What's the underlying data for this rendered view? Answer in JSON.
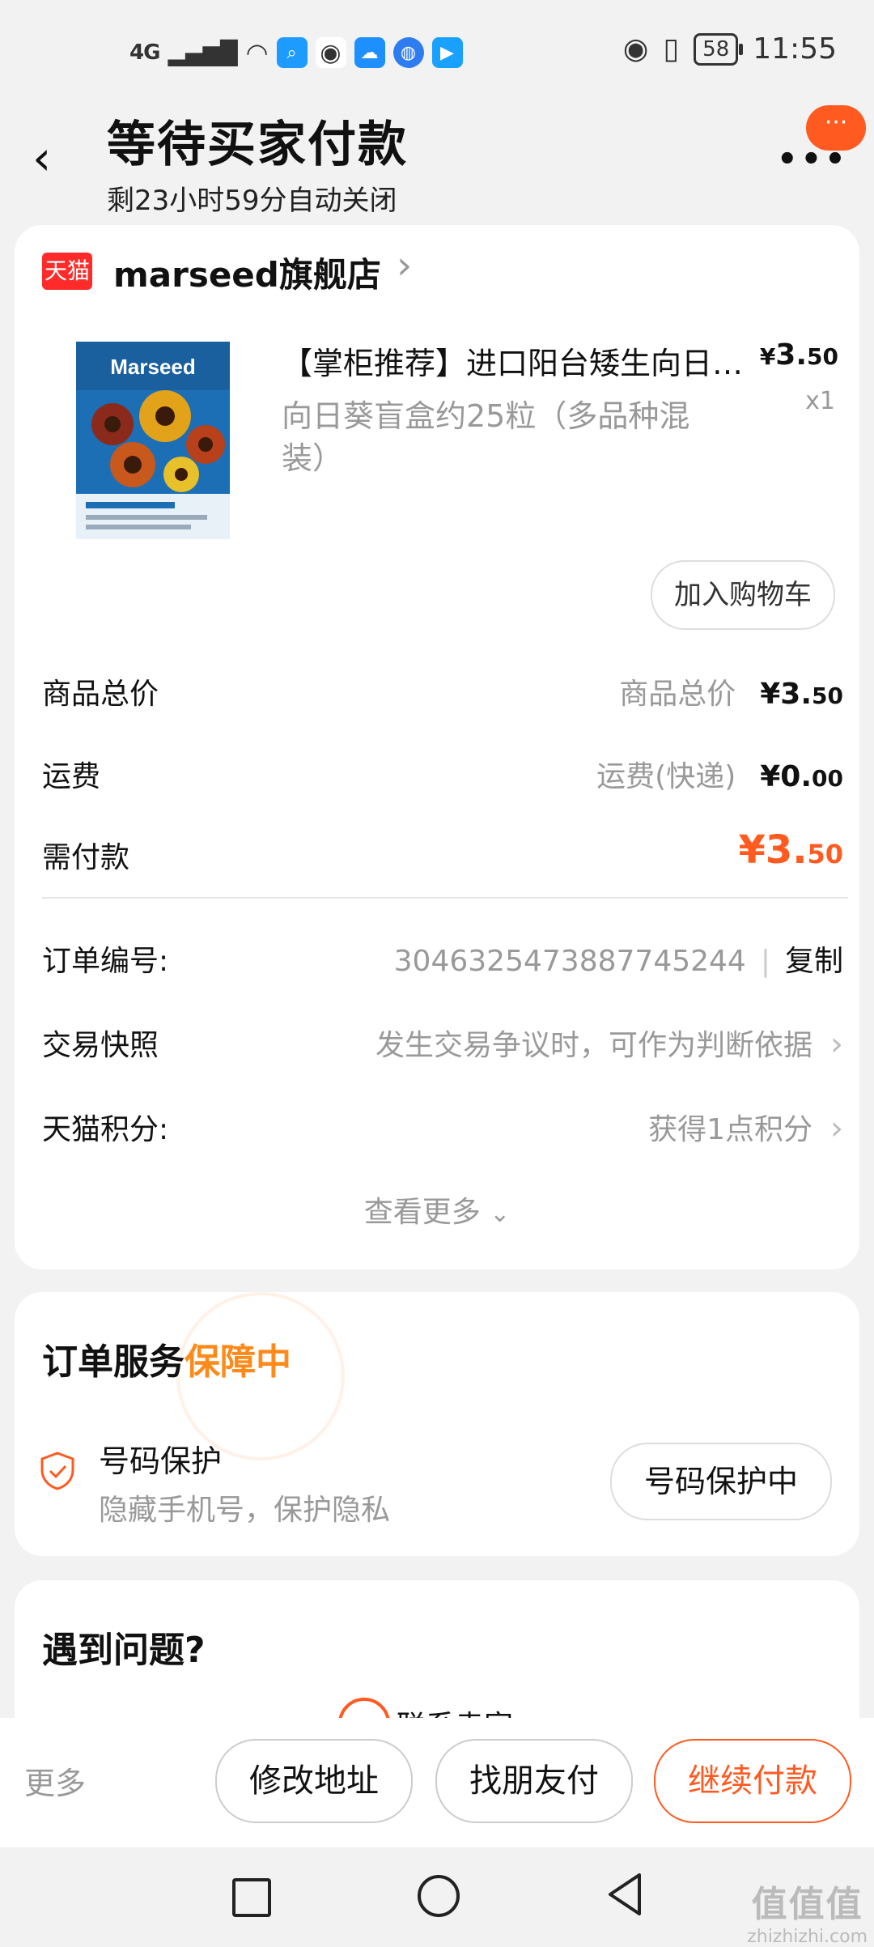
{
  "status_bar": {
    "network": "4G",
    "battery": "58",
    "time": "11:55"
  },
  "header": {
    "title": "等待买家付款",
    "subtitle": "剩23小时59分自动关闭",
    "more_bubble": "···"
  },
  "shop": {
    "badge": "天猫",
    "name": "marseed旗舰店"
  },
  "product": {
    "title": "【掌柜推荐】进口阳台矮生向日葵盲盒",
    "sku": "向日葵盲盒约25粒（多品种混装）",
    "price_currency": "¥",
    "price_int": "3.",
    "price_dec": "50",
    "qty": "x1",
    "add_to_cart": "加入购物车",
    "image_brand": "Marseed"
  },
  "summary": {
    "rows": [
      {
        "label": "商品总价",
        "note": "商品总价",
        "int": "¥3.",
        "dec": "50"
      },
      {
        "label": "运费",
        "note": "运费(快递)",
        "int": "¥0.",
        "dec": "00"
      },
      {
        "label": "需付款",
        "note": "",
        "int": "¥3.",
        "dec": "50"
      }
    ]
  },
  "order": {
    "number_label": "订单编号:",
    "number": "3046325473887745244",
    "copy": "复制",
    "snapshot_label": "交易快照",
    "snapshot_note": "发生交易争议时，可作为判断依据",
    "points_label": "天猫积分:",
    "points_note": "获得1点积分",
    "see_more": "查看更多"
  },
  "service": {
    "title_prefix": "订单服务",
    "title_highlight": "保障中",
    "item_name": "号码保护",
    "item_desc": "隐藏手机号，保护隐私",
    "item_button": "号码保护中"
  },
  "help": {
    "title": "遇到问题?",
    "contact": "联系卖家"
  },
  "bottom_bar": {
    "more": "更多",
    "modify_address": "修改地址",
    "friend_pay": "找朋友付",
    "continue_pay": "继续付款"
  },
  "watermark": {
    "logo": "值值值",
    "site": "zhizhizhi.com"
  },
  "colors": {
    "accent": "#ff5a1f",
    "highlight": "#ff8a1a",
    "tmall_red": "#ff2a2a",
    "muted": "#999999"
  }
}
